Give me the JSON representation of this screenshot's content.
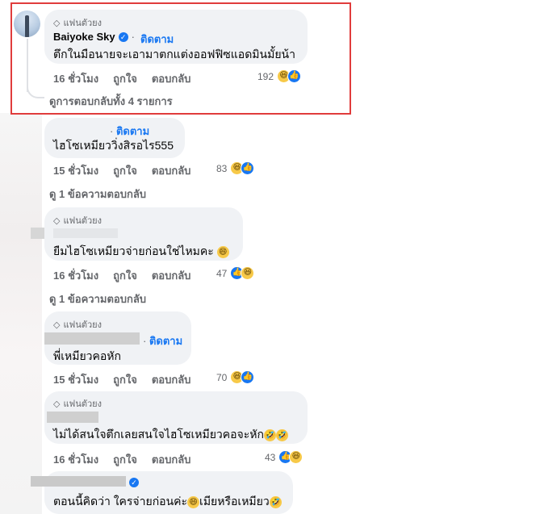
{
  "comments": [
    {
      "badge": "แฟนตัวยง",
      "name": "Baiyoke Sky",
      "follow": "ติดตาม",
      "text": "ตึกในมือนายจะเอามาตกแต่งออฟฟิซแอดมินมั้ยน้า",
      "time": "16 ชั่วโมง",
      "like": "ถูกใจ",
      "reply": "ตอบกลับ",
      "reaction_count": "192",
      "view_replies": "ดูการตอบกลับทั้ง 4 รายการ"
    },
    {
      "follow": "ติดตาม",
      "text": "ไฮโซเหมียววิ่งสิรอไร555",
      "time": "15 ชั่วโมง",
      "like": "ถูกใจ",
      "reply": "ตอบกลับ",
      "reaction_count": "83",
      "view_replies": "ดู 1 ข้อความตอบกลับ"
    },
    {
      "badge": "แฟนตัวยง",
      "text": "ยืมไฮโซเหมียวจ่ายก่อนใช่ไหมคะ",
      "time": "16 ชั่วโมง",
      "like": "ถูกใจ",
      "reply": "ตอบกลับ",
      "reaction_count": "47",
      "view_replies": "ดู 1 ข้อความตอบกลับ"
    },
    {
      "badge": "แฟนตัวยง",
      "follow": "ติดตาม",
      "text": "พี่เหมียวคอหัก",
      "time": "15 ชั่วโมง",
      "like": "ถูกใจ",
      "reply": "ตอบกลับ",
      "reaction_count": "70"
    },
    {
      "badge": "แฟนตัวยง",
      "text": "ไม่ได้สนใจตึกเลยสนใจไฮโซเหมียวคอจะหัก",
      "time": "16 ชั่วโมง",
      "like": "ถูกใจ",
      "reply": "ตอบกลับ",
      "reaction_count": "43"
    },
    {
      "text_a": "ตอนนี้คิดว่า ใครจ่ายก่อนค่ะ",
      "text_b": "เมียหรือเหมียว"
    }
  ],
  "icons": {
    "badge": "diamond-icon",
    "verified": "verified-check-icon",
    "reaction_haha": "haha-emoji-icon",
    "reaction_like": "like-thumb-icon"
  },
  "colors": {
    "link": "#1877f2",
    "meta": "#65676b",
    "bubble": "#f0f2f5",
    "highlight": "#e03c3c"
  }
}
